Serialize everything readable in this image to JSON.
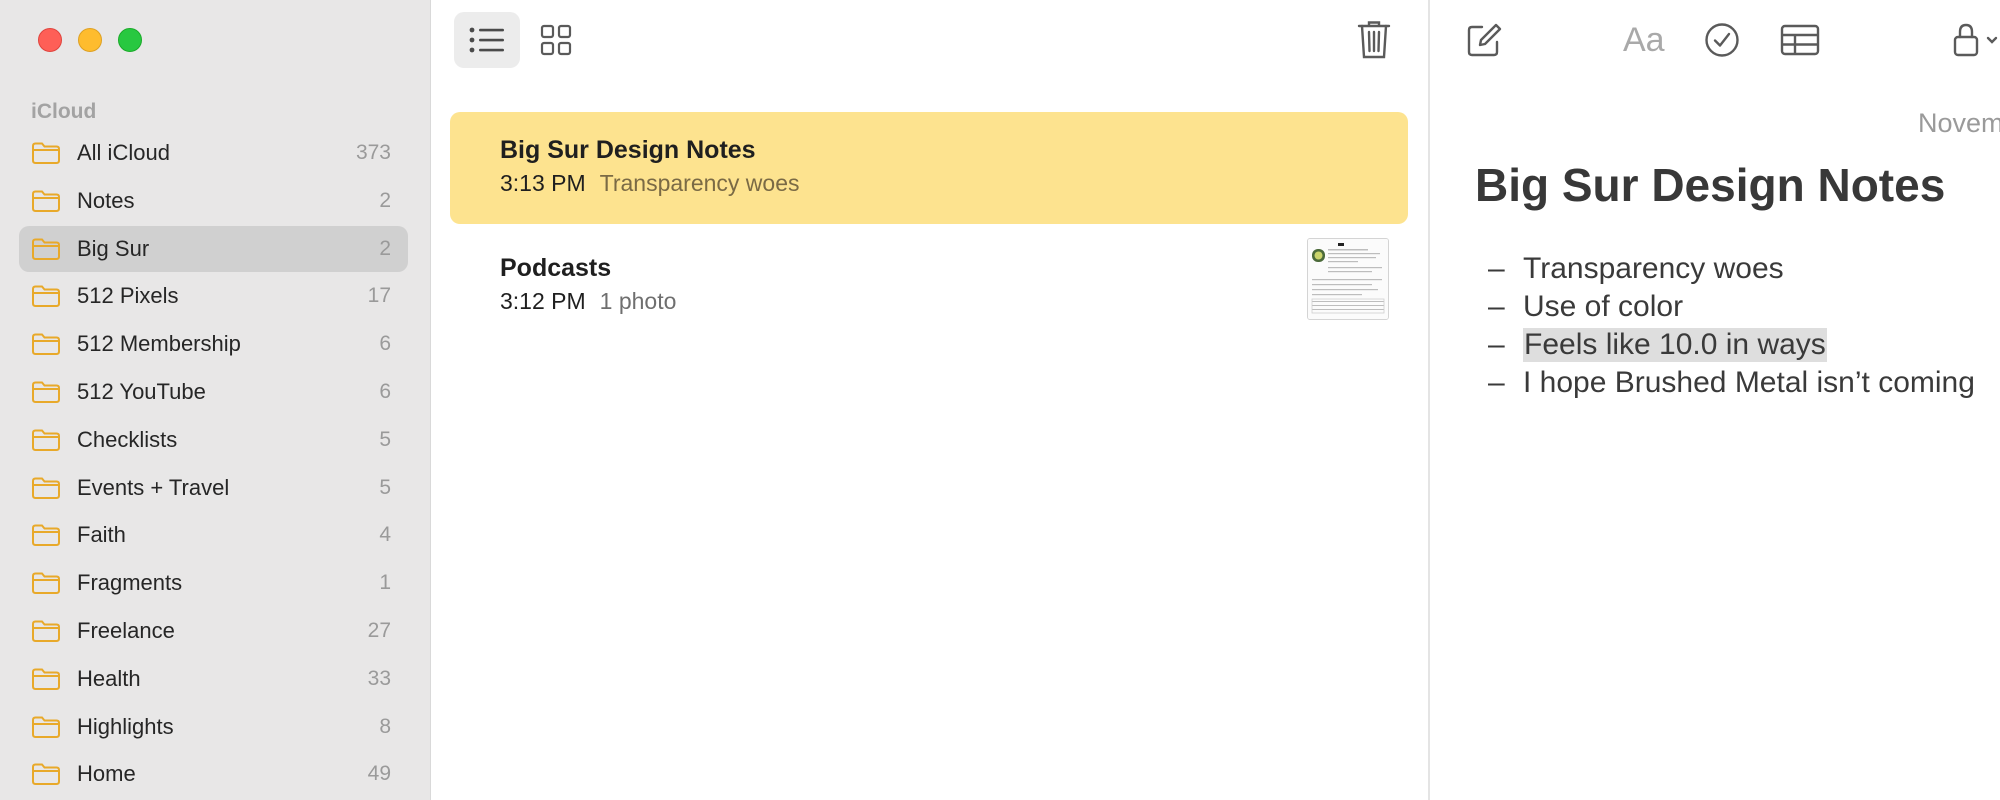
{
  "sidebar": {
    "section_label": "iCloud",
    "folders": [
      {
        "label": "All iCloud",
        "count": "373"
      },
      {
        "label": "Notes",
        "count": "2"
      },
      {
        "label": "Big Sur",
        "count": "2"
      },
      {
        "label": "512 Pixels",
        "count": "17"
      },
      {
        "label": "512 Membership",
        "count": "6"
      },
      {
        "label": "512 YouTube",
        "count": "6"
      },
      {
        "label": "Checklists",
        "count": "5"
      },
      {
        "label": "Events + Travel",
        "count": "5"
      },
      {
        "label": "Faith",
        "count": "4"
      },
      {
        "label": "Fragments",
        "count": "1"
      },
      {
        "label": "Freelance",
        "count": "27"
      },
      {
        "label": "Health",
        "count": "33"
      },
      {
        "label": "Highlights",
        "count": "8"
      },
      {
        "label": "Home",
        "count": "49"
      }
    ],
    "selected_folder": "Big Sur"
  },
  "note_list": {
    "notes": [
      {
        "title": "Big Sur Design Notes",
        "time": "3:13 PM",
        "preview": "Transparency woes"
      },
      {
        "title": "Podcasts",
        "time": "3:12 PM",
        "preview": "1 photo"
      }
    ]
  },
  "editor": {
    "date_fragment": "Novem",
    "format_label": "Aa",
    "title": "Big Sur Design Notes",
    "bullets": [
      "Transparency woes",
      "Use of color",
      "Feels like 10.0 in ways",
      "I hope Brushed Metal isn’t coming"
    ],
    "bullet_marker": "–"
  },
  "colors": {
    "sidebar_bg": "#e8e7e7",
    "selected_folder_bg": "#d0d0d0",
    "folder_icon": "#e8a92a",
    "selected_note_bg": "#fde38f",
    "text_highlight": "#dedede",
    "toolbar_icon": "#5a5a5a"
  },
  "icons": {
    "traffic_lights": [
      "close-icon",
      "minimize-icon",
      "zoom-icon"
    ],
    "view_toggles": [
      "list-view-icon",
      "gallery-view-icon"
    ],
    "editor_toolbar": [
      "compose-icon",
      "format-icon",
      "checklist-icon",
      "table-icon",
      "lock-icon"
    ]
  }
}
